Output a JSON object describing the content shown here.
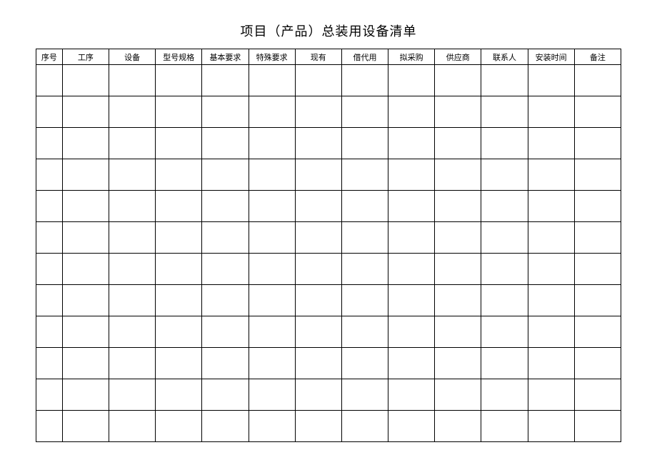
{
  "title": "项目（产品）总装用设备清单",
  "headers": [
    "序号",
    "工序",
    "设备",
    "型号规格",
    "基本要求",
    "特殊要求",
    "现有",
    "借代用",
    "拟采购",
    "供应商",
    "联系人",
    "安装时间",
    "备注"
  ],
  "row_count": 12
}
